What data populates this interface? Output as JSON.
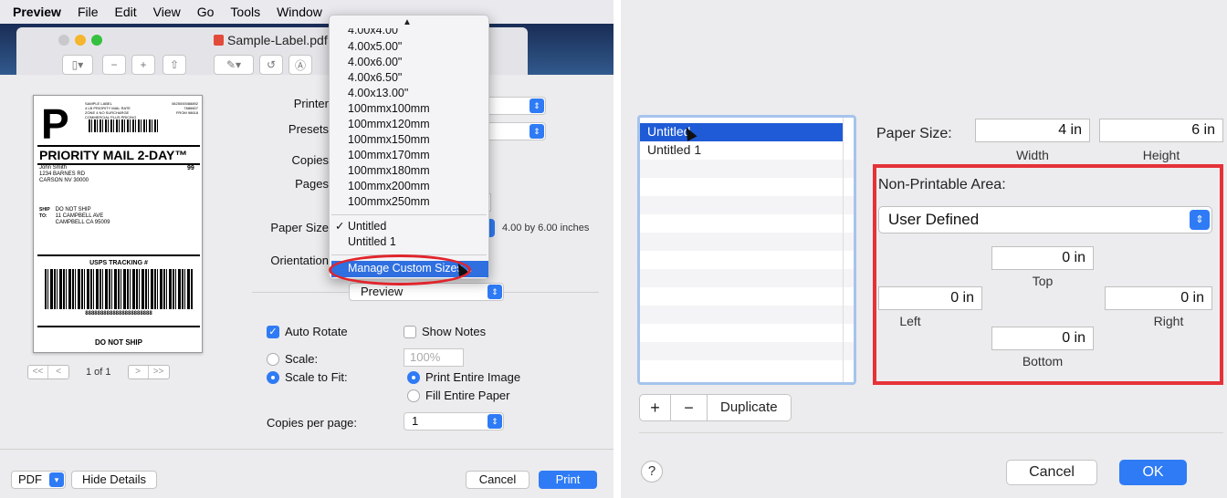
{
  "left": {
    "menubar": [
      "Preview",
      "File",
      "Edit",
      "View",
      "Go",
      "Tools",
      "Window"
    ],
    "window_title": "Sample-Label.pdf (",
    "label": {
      "big_letter": "P",
      "small_header": "SAMPLE LABEL\n4 LB PRIORITY MAIL RATE\nZONE 4 NO SURCHARGE\nCOMMERCIAL PLUS PRICING",
      "code": "0625000088892\n7686607\nFROM 98618",
      "service": "PRIORITY MAIL 2-DAY™",
      "from": "John Smith\n1234 BARNES RD\nCARSON NV 30000",
      "from_num": "99",
      "ship_label": "SHIP\nTO:",
      "ship_to": "DO NOT SHIP\n11 CAMPBELL AVE\nCAMPBELL CA 95009",
      "tracking_header": "USPS TRACKING #",
      "tracking_number": "8888888888888888888888",
      "footer": "DO NOT SHIP"
    },
    "pager": {
      "first": "<<",
      "prev": "<",
      "page": "1 of 1",
      "next": ">",
      "last": ">>"
    },
    "fields": {
      "printer": "Printer",
      "presets": "Presets",
      "copies": "Copies",
      "pages": "Pages",
      "paper_size": "Paper Size",
      "orientation": "Orientation",
      "paper_size_info": "4.00 by 6.00 inches"
    },
    "preview_popup": "Preview",
    "options": {
      "auto_rotate": "Auto Rotate",
      "show_notes": "Show Notes",
      "scale": "Scale:",
      "scale_value": "100%",
      "scale_to_fit": "Scale to Fit:",
      "print_entire_image": "Print Entire Image",
      "fill_entire_paper": "Fill Entire Paper",
      "copies_per_page": "Copies per page:",
      "copies_per_page_value": "1"
    },
    "bottom": {
      "pdf": "PDF",
      "hide_details": "Hide Details",
      "cancel": "Cancel",
      "print": "Print"
    },
    "menu": {
      "scroll_indicator": "▲",
      "items": [
        "4.00x4.00\"",
        "4.00x5.00\"",
        "4.00x6.00\"",
        "4.00x6.50\"",
        "4.00x13.00\"",
        "100mmx100mm",
        "100mmx120mm",
        "100mmx150mm",
        "100mmx170mm",
        "100mmx180mm",
        "100mmx200mm",
        "100mmx250mm"
      ],
      "checked_item": "✓ Untitled",
      "item2": "Untitled 1",
      "highlighted": "Manage Custom Sizes..."
    }
  },
  "right": {
    "list": [
      "Untitled",
      "Untitled 1"
    ],
    "paper_size_label": "Paper Size:",
    "width_value": "4 in",
    "height_value": "6 in",
    "width_label": "Width",
    "height_label": "Height",
    "non_printable_label": "Non-Printable Area:",
    "user_defined": "User Defined",
    "top_value": "0 in",
    "top_label": "Top",
    "left_value": "0 in",
    "left_label": "Left",
    "right_value": "0 in",
    "right_label": "Right",
    "bottom_value": "0 in",
    "bottom_label": "Bottom",
    "add": "+",
    "remove": "−",
    "duplicate": "Duplicate",
    "help": "?",
    "cancel": "Cancel",
    "ok": "OK"
  },
  "colors": {
    "accent": "#2f7bf5",
    "highlight": "#2f6fe0",
    "annotation_red": "#e53238"
  }
}
